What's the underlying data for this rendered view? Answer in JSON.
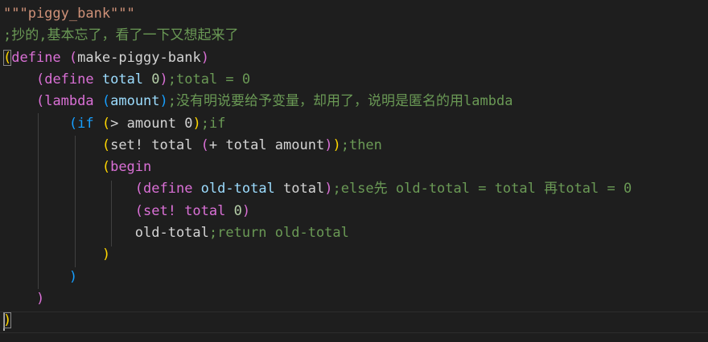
{
  "editor": {
    "colors": {
      "background": "#1e1e1e",
      "string": "#ce9178",
      "comment": "#6a9955",
      "keyword": "#569cd6",
      "identifier": "#9cdcfe",
      "number": "#b5cea8",
      "bracket_gold": "#ffd700",
      "bracket_orchid": "#da70d6",
      "bracket_blue": "#179fff"
    },
    "lines": [
      {
        "tokens": [
          {
            "text": "\"\"\"piggy_bank\"\"\"",
            "kind": "str"
          }
        ]
      },
      {
        "tokens": [
          {
            "text": ";抄的,基本忘了，看了一下又想起来了",
            "kind": "com"
          }
        ]
      },
      {
        "tokens": [
          {
            "text": "(",
            "kind": "b1",
            "match": true
          },
          {
            "text": "define ",
            "kind": "b2"
          },
          {
            "text": "(",
            "kind": "b2"
          },
          {
            "text": "make-piggy-bank",
            "kind": "txt"
          },
          {
            "text": ")",
            "kind": "b2"
          }
        ]
      },
      {
        "tokens": [
          {
            "text": "    ",
            "kind": "txt"
          },
          {
            "text": "(",
            "kind": "b2"
          },
          {
            "text": "define ",
            "kind": "b2"
          },
          {
            "text": "total ",
            "kind": "id"
          },
          {
            "text": "0",
            "kind": "num"
          },
          {
            "text": ")",
            "kind": "b2"
          },
          {
            "text": ";total = 0",
            "kind": "com"
          }
        ]
      },
      {
        "tokens": [
          {
            "text": "    ",
            "kind": "txt"
          },
          {
            "text": "(",
            "kind": "b2"
          },
          {
            "text": "lambda ",
            "kind": "b2"
          },
          {
            "text": "(",
            "kind": "b3"
          },
          {
            "text": "amount",
            "kind": "id"
          },
          {
            "text": ")",
            "kind": "b3"
          },
          {
            "text": ";没有明说要给予变量，却用了，说明是匿名的用lambda",
            "kind": "com"
          }
        ]
      },
      {
        "tokens": [
          {
            "text": "        ",
            "kind": "txt"
          },
          {
            "text": "(",
            "kind": "b3"
          },
          {
            "text": "if ",
            "kind": "b3"
          },
          {
            "text": "(",
            "kind": "b1"
          },
          {
            "text": "> amount 0",
            "kind": "txt"
          },
          {
            "text": ")",
            "kind": "b1"
          },
          {
            "text": ";if",
            "kind": "com"
          }
        ]
      },
      {
        "tokens": [
          {
            "text": "            ",
            "kind": "txt"
          },
          {
            "text": "(",
            "kind": "b1"
          },
          {
            "text": "set! total ",
            "kind": "txt"
          },
          {
            "text": "(",
            "kind": "b2"
          },
          {
            "text": "+ total amount",
            "kind": "txt"
          },
          {
            "text": ")",
            "kind": "b2"
          },
          {
            "text": ")",
            "kind": "b1"
          },
          {
            "text": ";then",
            "kind": "com"
          }
        ]
      },
      {
        "tokens": [
          {
            "text": "            ",
            "kind": "txt"
          },
          {
            "text": "(",
            "kind": "b1"
          },
          {
            "text": "begin",
            "kind": "b2"
          }
        ]
      },
      {
        "tokens": [
          {
            "text": "                ",
            "kind": "txt"
          },
          {
            "text": "(",
            "kind": "b2"
          },
          {
            "text": "define ",
            "kind": "b2"
          },
          {
            "text": "old-total ",
            "kind": "id"
          },
          {
            "text": "total",
            "kind": "txt"
          },
          {
            "text": ")",
            "kind": "b2"
          },
          {
            "text": ";else先 old-total = total 再total = 0",
            "kind": "com"
          }
        ]
      },
      {
        "tokens": [
          {
            "text": "                ",
            "kind": "txt"
          },
          {
            "text": "(",
            "kind": "b2"
          },
          {
            "text": "set! total ",
            "kind": "b2"
          },
          {
            "text": "0",
            "kind": "num"
          },
          {
            "text": ")",
            "kind": "b2"
          }
        ]
      },
      {
        "tokens": [
          {
            "text": "                ",
            "kind": "txt"
          },
          {
            "text": "old-total",
            "kind": "txt"
          },
          {
            "text": ";return old-total",
            "kind": "com"
          }
        ]
      },
      {
        "tokens": [
          {
            "text": "            ",
            "kind": "txt"
          },
          {
            "text": ")",
            "kind": "b1"
          }
        ]
      },
      {
        "tokens": [
          {
            "text": "        ",
            "kind": "txt"
          },
          {
            "text": ")",
            "kind": "b3"
          }
        ]
      },
      {
        "tokens": [
          {
            "text": "    ",
            "kind": "txt"
          },
          {
            "text": ")",
            "kind": "b2"
          }
        ]
      },
      {
        "tokens": [
          {
            "text": ")",
            "kind": "b1",
            "match": true
          }
        ]
      }
    ]
  }
}
